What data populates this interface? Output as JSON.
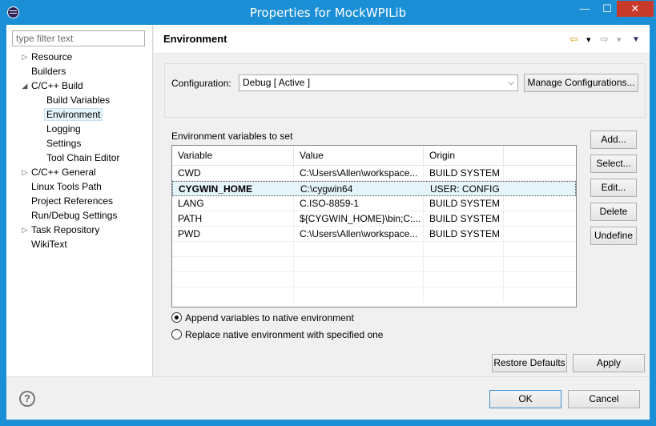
{
  "window": {
    "title": "Properties for MockWPILib",
    "minimize_glyph": "—",
    "maximize_glyph": "☐",
    "close_glyph": "✕"
  },
  "sidebar": {
    "filter_placeholder": "type filter text",
    "items": [
      {
        "label": "Resource",
        "arrow": "▷",
        "level": 0
      },
      {
        "label": "Builders",
        "arrow": "",
        "level": 0
      },
      {
        "label": "C/C++ Build",
        "arrow": "◢",
        "level": 0
      },
      {
        "label": "Build Variables",
        "arrow": "",
        "level": 1
      },
      {
        "label": "Environment",
        "arrow": "",
        "level": 1,
        "selected": true
      },
      {
        "label": "Logging",
        "arrow": "",
        "level": 1
      },
      {
        "label": "Settings",
        "arrow": "",
        "level": 1
      },
      {
        "label": "Tool Chain Editor",
        "arrow": "",
        "level": 1
      },
      {
        "label": "C/C++ General",
        "arrow": "▷",
        "level": 0
      },
      {
        "label": "Linux Tools Path",
        "arrow": "",
        "level": 0
      },
      {
        "label": "Project References",
        "arrow": "",
        "level": 0
      },
      {
        "label": "Run/Debug Settings",
        "arrow": "",
        "level": 0
      },
      {
        "label": "Task Repository",
        "arrow": "▷",
        "level": 0
      },
      {
        "label": "WikiText",
        "arrow": "",
        "level": 0
      }
    ]
  },
  "page": {
    "title": "Environment",
    "nav": {
      "back_glyph": "⇦",
      "forward_glyph": "⇨",
      "dropdown_glyph": "▾",
      "menu_glyph": "▼"
    },
    "configuration_label": "Configuration:",
    "configuration_value": "Debug  [ Active ]",
    "manage_button": "Manage Configurations...",
    "env_vars_label": "Environment variables to set",
    "columns": [
      "Variable",
      "Value",
      "Origin"
    ],
    "rows": [
      {
        "variable": "CWD",
        "value": "C:\\Users\\Allen\\workspace...",
        "origin": "BUILD SYSTEM"
      },
      {
        "variable": "CYGWIN_HOME",
        "value": "C:\\cygwin64",
        "origin": "USER: CONFIG",
        "selected": true
      },
      {
        "variable": "LANG",
        "value": "C.ISO-8859-1",
        "origin": "BUILD SYSTEM"
      },
      {
        "variable": "PATH",
        "value": "${CYGWIN_HOME}\\bin;C:...",
        "origin": "BUILD SYSTEM"
      },
      {
        "variable": "PWD",
        "value": "C:\\Users\\Allen\\workspace...",
        "origin": "BUILD SYSTEM"
      }
    ],
    "side_buttons": [
      "Add...",
      "Select...",
      "Edit...",
      "Delete",
      "Undefine"
    ],
    "radio_append": "Append variables to native environment",
    "radio_replace": "Replace native environment with specified one",
    "radio_selected": "append",
    "restore_defaults": "Restore Defaults",
    "apply": "Apply"
  },
  "footer": {
    "help_glyph": "?",
    "ok": "OK",
    "cancel": "Cancel"
  }
}
